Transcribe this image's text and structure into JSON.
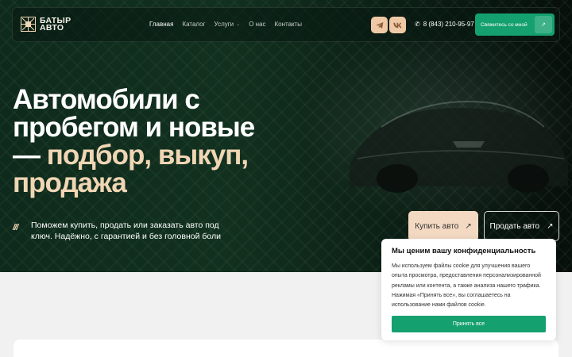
{
  "brand": {
    "line1": "БАТЫР",
    "line2": "АВТО"
  },
  "nav": {
    "items": [
      {
        "label": "Главная",
        "active": true
      },
      {
        "label": "Каталог"
      },
      {
        "label": "Услуги",
        "dropdown": true
      },
      {
        "label": "О нас"
      },
      {
        "label": "Контакты"
      }
    ]
  },
  "header": {
    "phone": "8 (843) 210-95-97",
    "contact_button": "Свяжитесь со мной",
    "contact_arrow": "↗",
    "social": [
      "telegram-icon",
      "vk-icon"
    ]
  },
  "hero": {
    "title_white": "Автомобили с пробегом и новые",
    "title_accent_dash": "—",
    "title_accent": "подбор, выкуп, продажа",
    "slashes": "///",
    "subtitle": "Поможем купить, продать или заказать авто под ключ. Надёжно, с гарантией и без головной боли",
    "buy_button": "Купить авто",
    "sell_button": "Продать авто",
    "arrow": "↗"
  },
  "cookie": {
    "title": "Мы ценим вашу конфиденциальность",
    "text": "Мы используем файлы cookie для улучшения вашего опыта просмотра, предоставления персонализированной рекламы или контента, а также анализа нашего трафика. Нажимая «Принять все», вы соглашаетесь на использование нами файлов cookie.",
    "accept_button": "Принять все"
  },
  "colors": {
    "accent_green": "#14a06f",
    "accent_beige": "#f0d6b4",
    "hero_bg": "#0e2a1c"
  }
}
